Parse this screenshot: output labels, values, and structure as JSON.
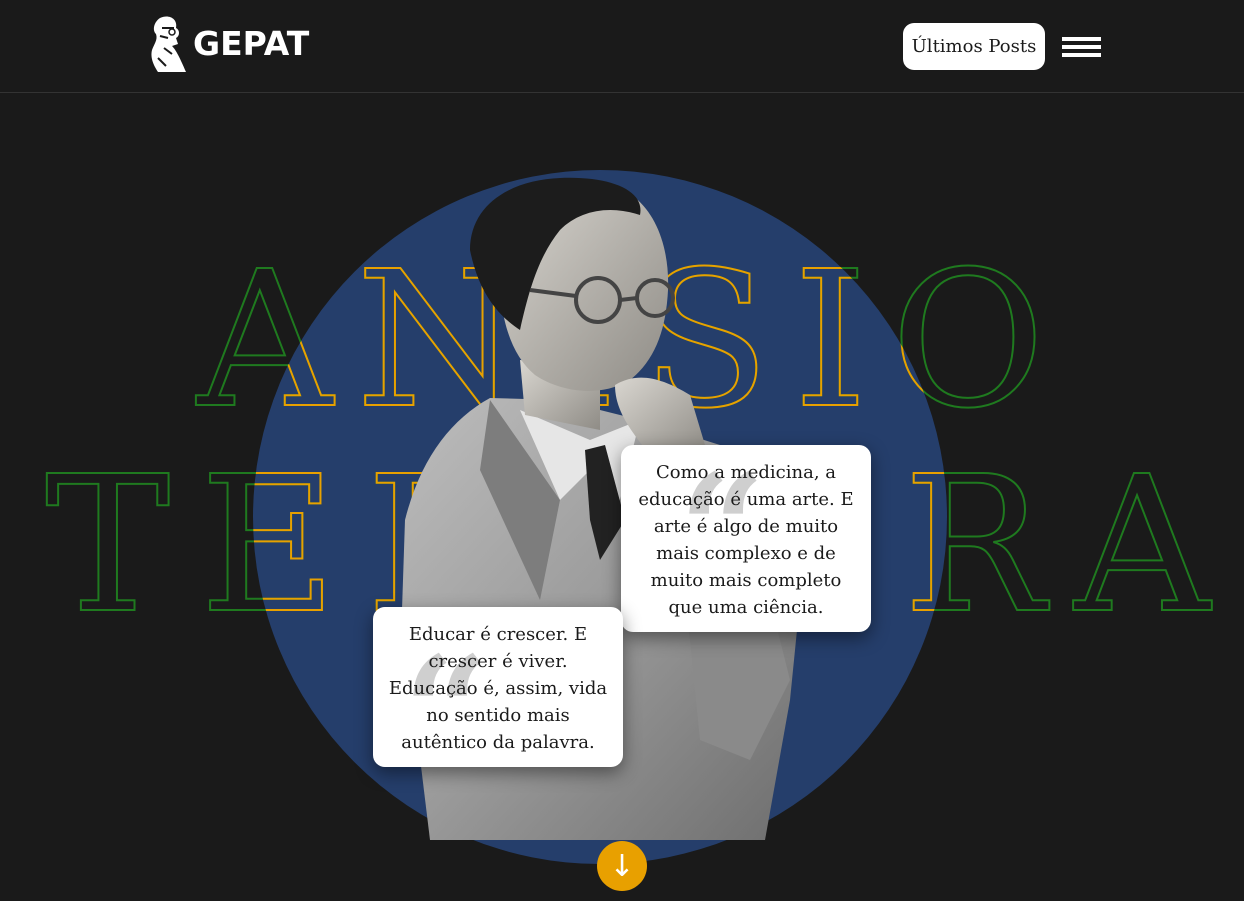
{
  "header": {
    "logo_text": "GEPAT",
    "posts_button": "Últimos Posts",
    "menu_icon": "hamburger-menu-icon"
  },
  "hero": {
    "name_line_1": "ANISIO",
    "name_line_2": "TEIXEIRA",
    "colors": {
      "circle": "#253e6b",
      "outline_green": "#1f7a1f",
      "outline_yellow": "#e8a000",
      "background": "#1a1a1a"
    }
  },
  "quotes": [
    {
      "text": "Como a medicina, a educação é uma arte. E arte é algo de muito mais complexo e de muito mais completo que uma ciência."
    },
    {
      "text": "Educar é crescer. E crescer é viver. Educação é, assim, vida no sentido mais autêntico da palavra."
    }
  ],
  "scroll_button": {
    "icon": "arrow-down-icon",
    "glyph": "↓"
  }
}
